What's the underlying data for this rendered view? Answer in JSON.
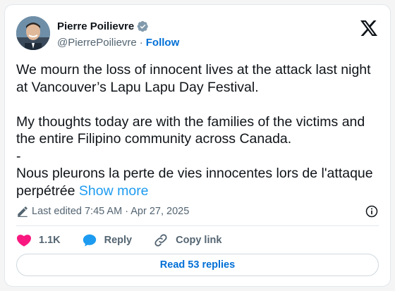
{
  "author": {
    "display_name": "Pierre Poilievre",
    "handle": "@PierrePoilievre",
    "separator": "·",
    "follow_label": "Follow",
    "verified_icon": "verified-badge-icon",
    "verified_color": "#829aab"
  },
  "brand_icon": "x-logo-icon",
  "tweet": {
    "paragraph1": "We mourn the loss of innocent lives at the attack last night at Vancouver’s Lapu Lapu Day Festival.",
    "paragraph2": "My thoughts today are with the families of the victims and the entire Filipino community across Canada.",
    "line_dash": "-",
    "paragraph3": "Nous pleurons la perte de vies innocentes lors de l'attaque perpétrée",
    "show_more": "Show more"
  },
  "meta": {
    "edited_label": "Last edited 7:45 AM · Apr 27, 2025"
  },
  "actions": {
    "like_count": "1.1K",
    "reply_label": "Reply",
    "copy_link_label": "Copy link"
  },
  "read_replies_label": "Read 53 replies",
  "colors": {
    "link_blue": "#006fd6",
    "show_more_blue": "#1d9bf0",
    "like_pink": "#f91880",
    "reply_blue": "#1d9bf0",
    "muted_gray": "#536471"
  }
}
